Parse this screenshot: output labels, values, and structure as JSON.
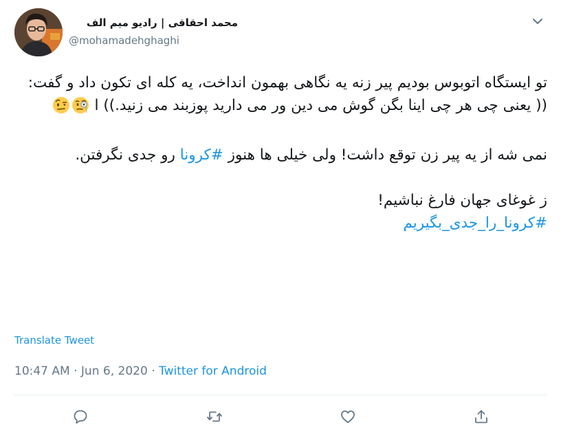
{
  "author": {
    "name": "محمد احقاقی | رادیو میم الف",
    "handle": "@mohamadehghaghi",
    "avatar": "avatar-photo"
  },
  "tweet": {
    "para1": "تو ایستگاه اتوبوس بودیم پیر زنه یه نگاهی بهمون انداخت، یه کله ای تکون داد و گفت: (( یعنی چی هر چی اینا بگن گوش می دین ور می دارید پوزبند می زنید.)) ا",
    "emoji": [
      "face-with-monocle",
      "face-with-raised-eyebrow"
    ],
    "para2": "نمی شه از یه پیر زن توقع داشت! ولی خیلی ها هنوز",
    "hashtag1": "#کرونا",
    "para2_end": "رو جدی نگرفتن.",
    "para3": "ز غوغای جهان فارغ نباشیم!",
    "hashtag2": "#کرونا_را_جدی_بگیریم"
  },
  "translate_label": "Translate Tweet",
  "meta": {
    "time": "10:47 AM",
    "separator": "·",
    "date": "Jun 6, 2020",
    "source": "Twitter for Android"
  },
  "actions": [
    "reply-icon",
    "retweet-icon",
    "like-icon",
    "share-icon"
  ],
  "colors": {
    "link": "#1b95e0",
    "secondary_text": "#657786",
    "divider": "#e6ecf0"
  }
}
